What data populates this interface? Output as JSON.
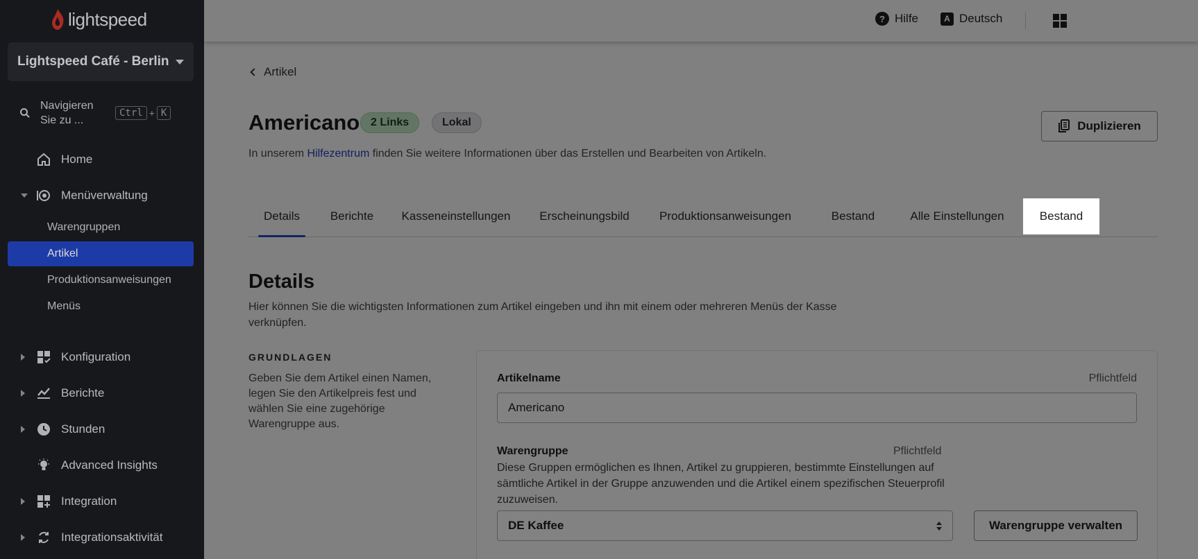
{
  "brand": {
    "logo_text": "lightspeed"
  },
  "sidebar": {
    "store_name": "Lightspeed Café - Berlin",
    "search": {
      "label": "Navigieren Sie zu ...",
      "key1": "Ctrl",
      "plus": "+",
      "key2": "K"
    },
    "items": [
      {
        "label": "Home",
        "icon": "home-icon"
      },
      {
        "label": "Menüverwaltung",
        "icon": "menu-management-icon",
        "expanded": true
      },
      {
        "label": "Konfiguration",
        "icon": "configuration-icon"
      },
      {
        "label": "Berichte",
        "icon": "reports-icon"
      },
      {
        "label": "Stunden",
        "icon": "clock-icon"
      },
      {
        "label": "Advanced Insights",
        "icon": "lightbulb-icon"
      },
      {
        "label": "Integration",
        "icon": "integration-icon"
      },
      {
        "label": "Integrationsaktivität",
        "icon": "sync-icon"
      }
    ],
    "sub_items": [
      {
        "label": "Warengruppen"
      },
      {
        "label": "Artikel",
        "active": true
      },
      {
        "label": "Produktionsanweisungen"
      },
      {
        "label": "Menüs"
      }
    ]
  },
  "topbar": {
    "help_label": "Hilfe",
    "help_glyph": "?",
    "language_label": "Deutsch",
    "language_glyph": "A"
  },
  "page": {
    "back_label": "Artikel",
    "title": "Americano",
    "badge_links": "2 Links",
    "badge_local": "Lokal",
    "duplicate_label": "Duplizieren",
    "help_prefix": "In unserem ",
    "help_link": "Hilfezentrum",
    "help_suffix": " finden Sie weitere Informationen über das Erstellen und Bearbeiten von Artikeln.",
    "tabs": [
      {
        "label": "Details",
        "selected": true
      },
      {
        "label": "Berichte"
      },
      {
        "label": "Kasseneinstellungen"
      },
      {
        "label": "Erscheinungsbild"
      },
      {
        "label": "Produktionsanweisungen"
      },
      {
        "label": "Bestand",
        "highlighted": true
      },
      {
        "label": "Alle Einstellungen"
      }
    ],
    "section_title": "Details",
    "section_desc": "Hier können Sie die wichtigsten Informationen zum Artikel eingeben und ihn mit einem oder mehreren Menüs der Kasse verknüpfen.",
    "group_title": "GRUNDLAGEN",
    "group_desc": "Geben Sie dem Artikel einen Namen, legen Sie den Artikelpreis fest und wählen Sie eine zugehörige Warengruppe aus.",
    "form": {
      "name_label": "Artikelname",
      "name_required": "Pflichtfeld",
      "name_value": "Americano",
      "group_label": "Warengruppe",
      "group_required": "Pflichtfeld",
      "group_help": "Diese Gruppen ermöglichen es Ihnen, Artikel zu gruppieren, bestimmte Einstellungen auf sämtliche Artikel in der Gruppe anzuwenden und die Artikel einem spezifischen Steuerprofil zuzuweisen.",
      "group_value": "DE Kaffee",
      "manage_label": "Warengruppe verwalten"
    }
  },
  "colors": {
    "accent": "#2346c4",
    "sidebar_bg": "#1c1d22",
    "badge_green": "#bfe3c3"
  }
}
